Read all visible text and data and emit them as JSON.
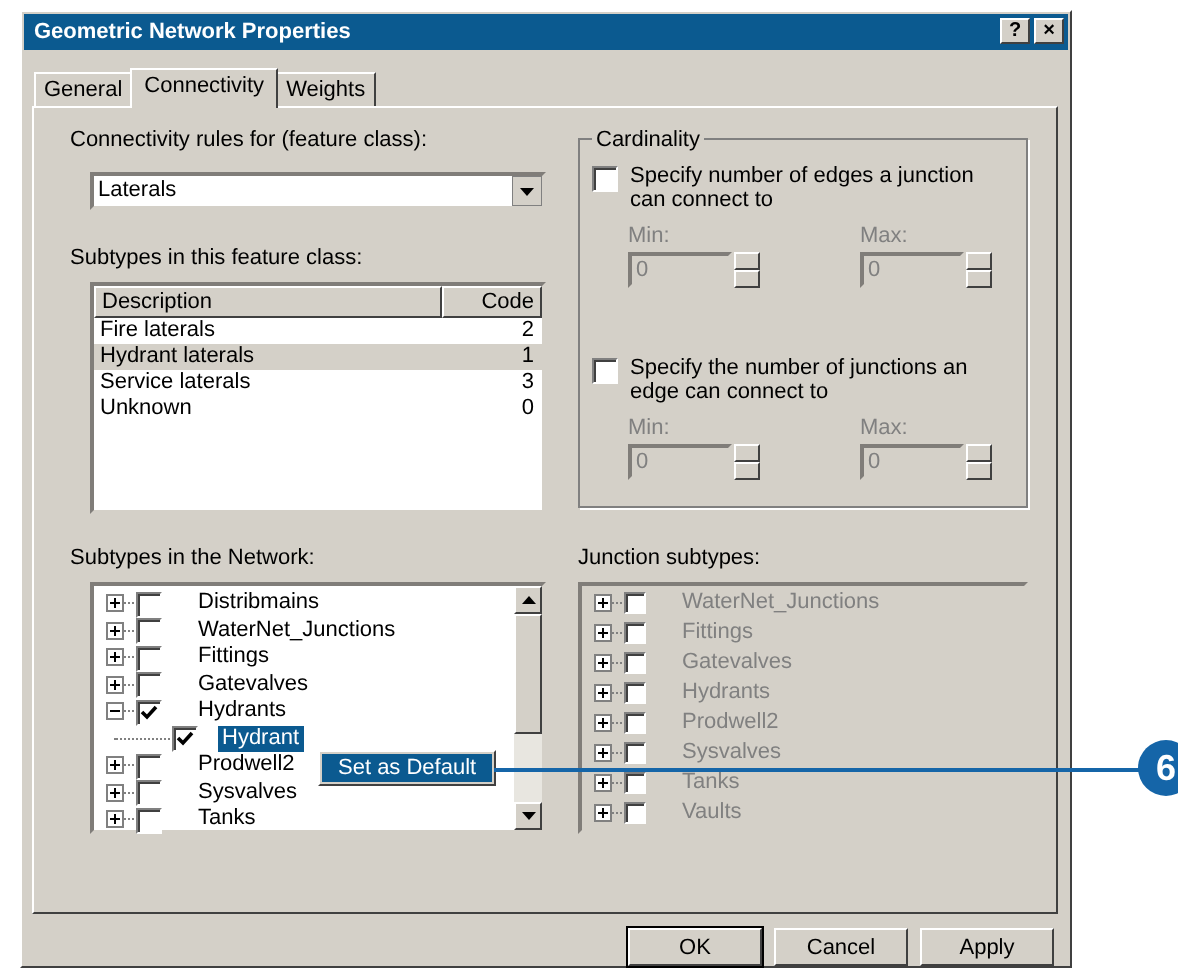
{
  "window": {
    "title": "Geometric Network Properties",
    "title_buttons": [
      "?",
      "×"
    ]
  },
  "tabs": [
    {
      "label": "General",
      "selected": false
    },
    {
      "label": "Connectivity",
      "selected": true
    },
    {
      "label": "Weights",
      "selected": false
    }
  ],
  "rules": {
    "label": "Connectivity rules for (feature class):",
    "value": "Laterals"
  },
  "subtypes": {
    "label": "Subtypes in this feature class:",
    "columns": [
      "Description",
      "Code"
    ],
    "rows": [
      {
        "description": "Fire laterals",
        "code": "2",
        "selected": false
      },
      {
        "description": "Hydrant laterals",
        "code": "1",
        "selected": true
      },
      {
        "description": "Service laterals",
        "code": "3",
        "selected": false
      },
      {
        "description": "Unknown",
        "code": "0",
        "selected": false
      }
    ]
  },
  "cardinality": {
    "title": "Cardinality",
    "sections": [
      {
        "label": "Specify number of edges a junction can connect to",
        "checked": false,
        "min_label": "Min:",
        "min_value": "0",
        "max_label": "Max:",
        "max_value": "0",
        "disabled": true
      },
      {
        "label": "Specify the number of junctions an edge can connect to",
        "checked": false,
        "min_label": "Min:",
        "min_value": "0",
        "max_label": "Max:",
        "max_value": "0",
        "disabled": true
      }
    ]
  },
  "network_subtypes": {
    "label": "Subtypes in the Network:",
    "items": [
      {
        "label": "Distribmains",
        "checked": false,
        "expanded": false
      },
      {
        "label": "WaterNet_Junctions",
        "checked": false,
        "expanded": false
      },
      {
        "label": "Fittings",
        "checked": false,
        "expanded": false
      },
      {
        "label": "Gatevalves",
        "checked": false,
        "expanded": false
      },
      {
        "label": "Hydrants",
        "checked": true,
        "expanded": true,
        "children": [
          {
            "label": "Hydrant",
            "checked": true,
            "selected": true
          }
        ]
      },
      {
        "label": "Prodwell2",
        "checked": false,
        "expanded": false
      },
      {
        "label": "Sysvalves",
        "checked": false,
        "expanded": false
      },
      {
        "label": "Tanks",
        "checked": false,
        "expanded": false
      }
    ]
  },
  "context_menu": {
    "items": [
      {
        "label": "Set as Default",
        "selected": true
      }
    ]
  },
  "junction_subtypes": {
    "label": "Junction subtypes:",
    "disabled": true,
    "items": [
      {
        "label": "WaterNet_Junctions",
        "checked": false,
        "expanded": false
      },
      {
        "label": "Fittings",
        "checked": false,
        "expanded": false
      },
      {
        "label": "Gatevalves",
        "checked": false,
        "expanded": false
      },
      {
        "label": "Hydrants",
        "checked": false,
        "expanded": false
      },
      {
        "label": "Prodwell2",
        "checked": false,
        "expanded": false
      },
      {
        "label": "Sysvalves",
        "checked": false,
        "expanded": false
      },
      {
        "label": "Tanks",
        "checked": false,
        "expanded": false
      },
      {
        "label": "Vaults",
        "checked": false,
        "expanded": false
      }
    ]
  },
  "buttons": [
    "OK",
    "Cancel",
    "Apply"
  ],
  "callout": "6"
}
